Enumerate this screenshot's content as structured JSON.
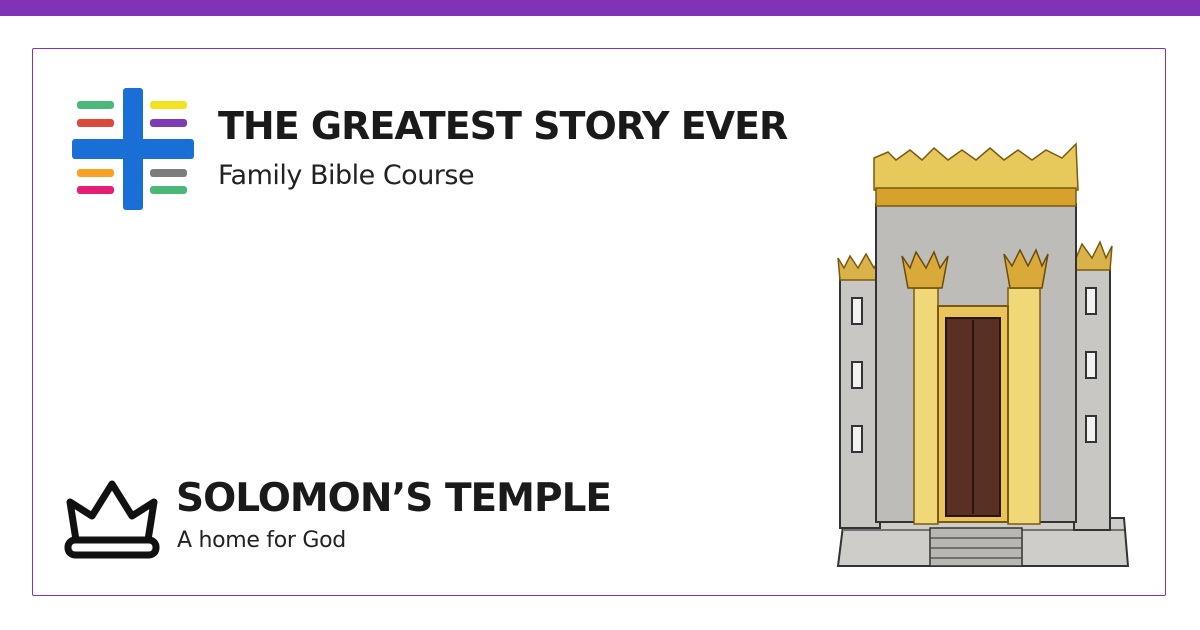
{
  "brand": {
    "title": "THE GREATEST STORY EVER",
    "subtitle": "Family Bible Course",
    "logo_icon": "cross-stripes-logo-icon"
  },
  "lesson": {
    "title": "SOLOMON’S TEMPLE",
    "subtitle": "A home for God",
    "icon": "crown-icon"
  },
  "illustration": {
    "subject": "temple-illustration"
  },
  "colors": {
    "accent": "#8034b5",
    "logo_blue": "#1a6fd6",
    "stripe_green": "#4bb87a",
    "stripe_red": "#dc4a3a",
    "stripe_yellow": "#f2e21f",
    "stripe_purple": "#7d3bb8",
    "stripe_orange": "#f7a224",
    "stripe_pink": "#e61e75",
    "stripe_gray": "#7c7c7c",
    "text": "#1a1a1a"
  }
}
